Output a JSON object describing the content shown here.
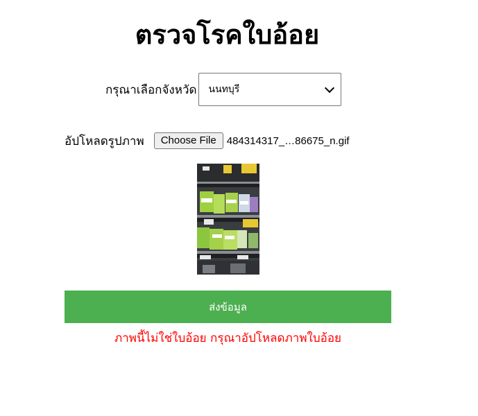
{
  "page": {
    "title": "ตรวจโรคใบอ้อย"
  },
  "form": {
    "province_label": "กรุณาเลือกจังหวัด",
    "province_selected": "นนทบุรี",
    "upload_label": "อัปโหลดรูปภาพ",
    "file_button_label": "Choose File",
    "file_name": "484314317_…86675_n.gif",
    "submit_label": "ส่งข้อมูล"
  },
  "result": {
    "error_message": "ภาพนี้ไม่ใช่ใบอ้อย กรุณาอัปโหลดภาพใบอ้อย",
    "error_color": "#ff0000"
  },
  "colors": {
    "submit_background": "#4caf50",
    "submit_text": "#ffffff"
  },
  "icons": {
    "select_arrow": "chevron-down-icon"
  }
}
